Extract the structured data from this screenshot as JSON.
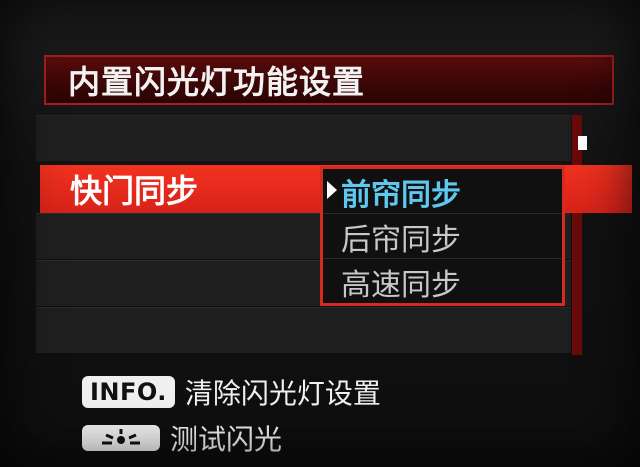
{
  "menu": {
    "title": "内置闪光灯功能设置",
    "selected_row": {
      "label": "快门同步"
    },
    "options": [
      {
        "label": "前帘同步",
        "current": true
      },
      {
        "label": "后帘同步",
        "current": false
      },
      {
        "label": "高速同步",
        "current": false
      }
    ]
  },
  "help": {
    "info_key": "INFO.",
    "info_text": "清除闪光灯设置",
    "flash_key_icon": "flash-burst-icon",
    "flash_text": "测试闪光"
  },
  "colors": {
    "title_bg": "#3a0606",
    "selection_red": "#e82a1c",
    "current_option": "#5ec8f0"
  }
}
